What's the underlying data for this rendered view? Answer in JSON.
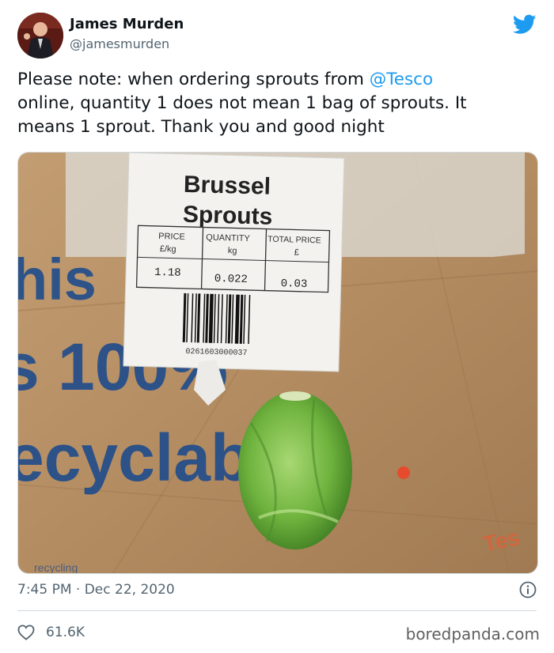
{
  "author": {
    "name": "James Murden",
    "handle": "@jamesmurden"
  },
  "tweet": {
    "line1_before": "Please note: when ordering sprouts from ",
    "mention": "@Tesco",
    "line2": " online, quantity 1 does not mean 1 bag of sprouts. It",
    "line3": "means 1 sprout. Thank you and good night"
  },
  "photo": {
    "label_title_1": "Brussel",
    "label_title_2": "Sprouts",
    "col_price": "PRICE",
    "col_price_unit": "£/kg",
    "col_quantity": "QUANTITY",
    "col_quantity_unit": "kg",
    "col_total": "TOTAL PRICE",
    "col_total_unit": "£",
    "price_value": "1.18",
    "quantity_value": "0.022",
    "total_value": "0.03",
    "barcode_number": "0261603000037",
    "bag_text_1": "his",
    "bag_text_2": "s 100%",
    "bag_text_3": "ecyclable.",
    "bag_text_4": "Tes",
    "bag_text_5": "recycling"
  },
  "meta": {
    "time": "7:45 PM · Dec 22, 2020",
    "likes": "61.6K"
  },
  "watermark": "boredpanda.com",
  "colors": {
    "link": "#1d9bf0",
    "twitter_blue": "#1d9bf0",
    "secondary_text": "#536471"
  },
  "icons": [
    "twitter-bird-icon",
    "info-icon",
    "heart-icon"
  ]
}
